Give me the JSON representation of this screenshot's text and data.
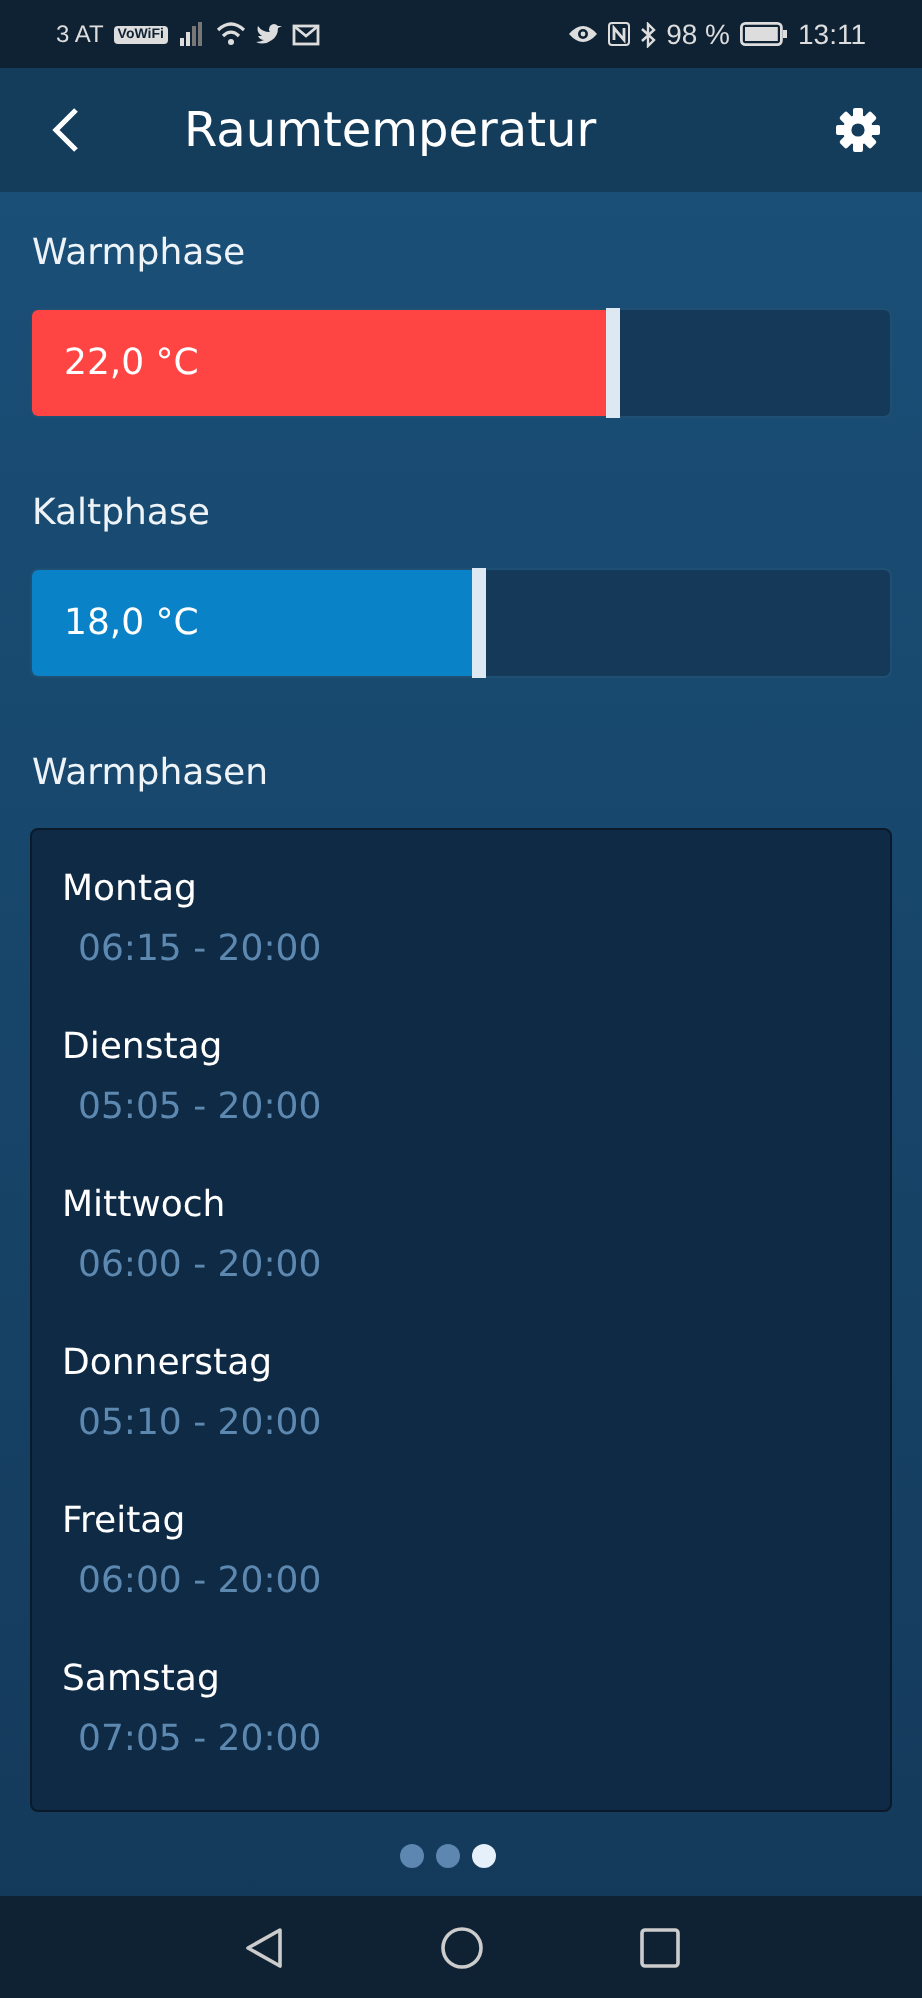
{
  "status_bar": {
    "carrier": "3 AT",
    "wifi_calling": "VoWiFi",
    "battery": "98 %",
    "time": "13:11"
  },
  "header": {
    "title": "Raumtemperatur"
  },
  "sliders": [
    {
      "label": "Warmphase",
      "value": "22,0 °C",
      "level": 0.675,
      "color": "#ff4444"
    },
    {
      "label": "Kaltphase",
      "value": "18,0 °C",
      "level": 0.52,
      "color": "#0a82c8"
    }
  ],
  "schedule": {
    "title": "Warmphasen",
    "days": [
      {
        "day": "Montag",
        "time": "06:15 - 20:00"
      },
      {
        "day": "Dienstag",
        "time": "05:05 - 20:00"
      },
      {
        "day": "Mittwoch",
        "time": "06:00 - 20:00"
      },
      {
        "day": "Donnerstag",
        "time": "05:10 - 20:00"
      },
      {
        "day": "Freitag",
        "time": "06:00 - 20:00"
      },
      {
        "day": "Samstag",
        "time": "07:05 - 20:00"
      }
    ]
  },
  "pager": [
    {
      "selected": false
    },
    {
      "selected": false
    },
    {
      "selected": true
    }
  ]
}
